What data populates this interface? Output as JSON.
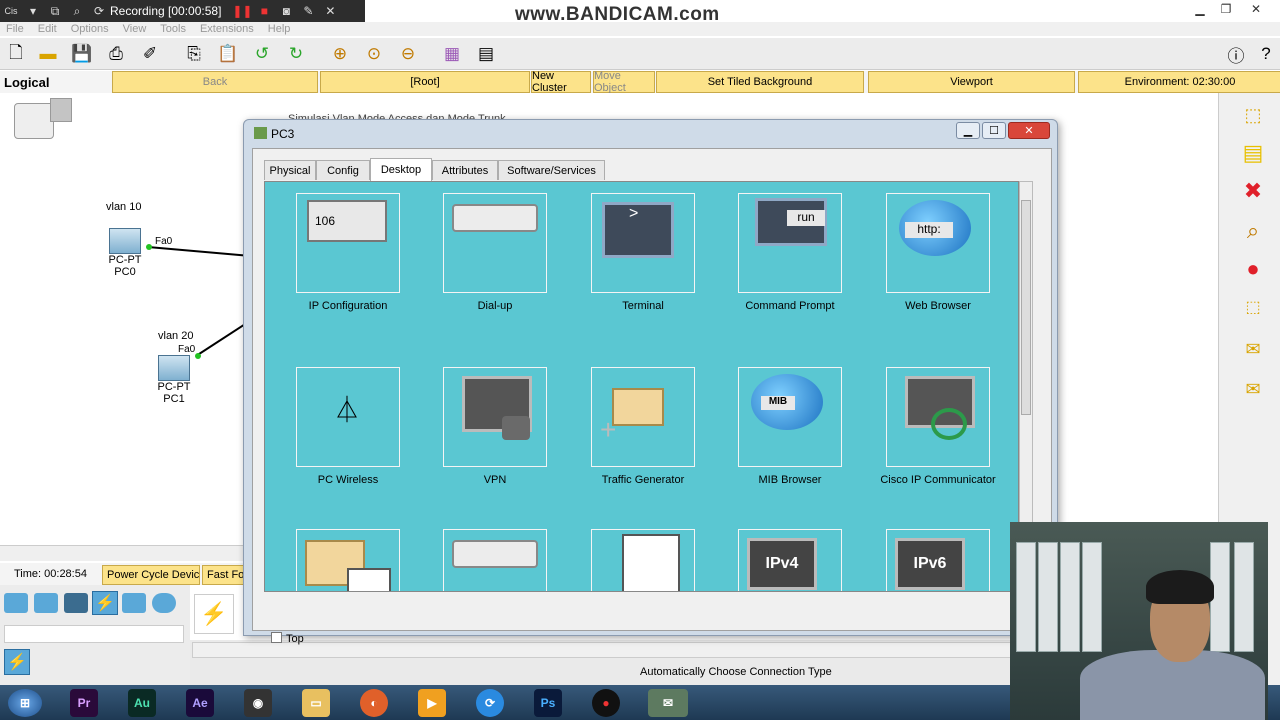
{
  "recording": {
    "label": "Recording [00:00:58]",
    "app_abbrev": "Cis"
  },
  "watermark": "www.BANDICAM.com",
  "menu": [
    "File",
    "Edit",
    "Options",
    "View",
    "Tools",
    "Extensions",
    "Help"
  ],
  "logical_bar": {
    "label": "Logical",
    "back": "Back",
    "root": "[Root]",
    "new_cluster": "New Cluster",
    "move_object": "Move Object",
    "set_tiled_background": "Set Tiled Background",
    "viewport": "Viewport",
    "environment": "Environment: 02:30:00"
  },
  "workspace": {
    "topology_title": "Simulasi Vlan Mode Access dan Mode Trunk",
    "pc0": {
      "vlan": "vlan 10",
      "port": "Fa0",
      "type": "PC-PT",
      "name": "PC0"
    },
    "pc1": {
      "vlan": "vlan 20",
      "port": "Fa0",
      "type": "PC-PT",
      "name": "PC1"
    }
  },
  "status": {
    "time": "Time: 00:28:54",
    "power_cycle": "Power Cycle Devices",
    "fast_forward": "Fast Forw"
  },
  "connection_hint": "Automatically Choose Connection Type",
  "dialog": {
    "title": "PC3",
    "tabs": [
      "Physical",
      "Config",
      "Desktop",
      "Attributes",
      "Software/Services"
    ],
    "active_tab": "Desktop",
    "apps": [
      {
        "label": "IP Configuration",
        "icon": "ip-config-icon",
        "icon_text": "106"
      },
      {
        "label": "Dial-up",
        "icon": "modem-icon",
        "icon_text": ""
      },
      {
        "label": "Terminal",
        "icon": "terminal-icon",
        "icon_text": ">"
      },
      {
        "label": "Command Prompt",
        "icon": "command-prompt-icon",
        "icon_text": "run"
      },
      {
        "label": "Web Browser",
        "icon": "web-browser-icon",
        "icon_text": "http:"
      },
      {
        "label": "PC Wireless",
        "icon": "wireless-tower-icon",
        "icon_text": ""
      },
      {
        "label": "VPN",
        "icon": "vpn-lock-icon",
        "icon_text": ""
      },
      {
        "label": "Traffic Generator",
        "icon": "traffic-generator-icon",
        "icon_text": ""
      },
      {
        "label": "MIB Browser",
        "icon": "mib-browser-icon",
        "icon_text": "MIB"
      },
      {
        "label": "Cisco IP Communicator",
        "icon": "ip-communicator-icon",
        "icon_text": ""
      },
      {
        "label": "",
        "icon": "email-icon",
        "icon_text": ""
      },
      {
        "label": "",
        "icon": "pppoe-dialer-icon",
        "icon_text": ""
      },
      {
        "label": "",
        "icon": "text-editor-icon",
        "icon_text": ""
      },
      {
        "label": "",
        "icon": "ipv4-firewall-icon",
        "icon_text": "IPv4"
      },
      {
        "label": "",
        "icon": "ipv6-firewall-icon",
        "icon_text": "IPv6"
      }
    ],
    "top_checkbox": "Top"
  },
  "taskbar": [
    "Pr",
    "Au",
    "Ae",
    "Ps"
  ],
  "colors": {
    "desktop_bg": "#5ac7d2",
    "yellow_button": "#fce38a",
    "taskbar": "#1e3953"
  }
}
